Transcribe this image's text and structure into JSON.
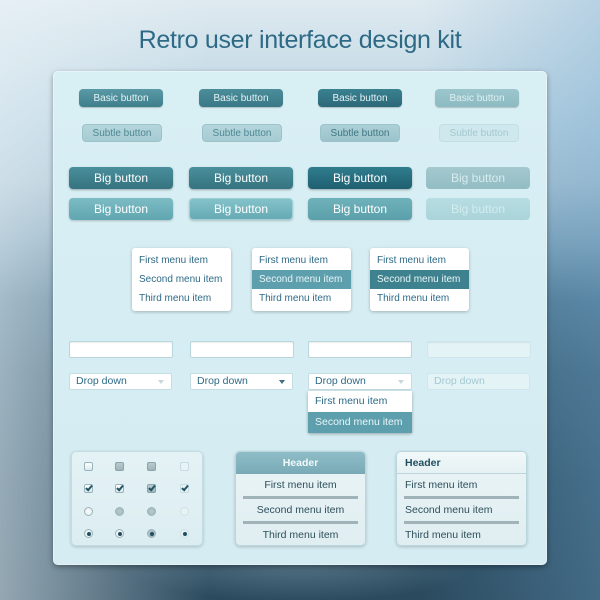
{
  "title": "Retro user interface design kit",
  "basic_buttons": [
    {
      "label": "Basic button",
      "state": "normal"
    },
    {
      "label": "Basic button",
      "state": "hover"
    },
    {
      "label": "Basic button",
      "state": "pressed"
    },
    {
      "label": "Basic button",
      "state": "disabled"
    }
  ],
  "subtle_buttons": [
    {
      "label": "Subtle button",
      "state": "normal"
    },
    {
      "label": "Subtle button",
      "state": "hover"
    },
    {
      "label": "Subtle button",
      "state": "pressed"
    },
    {
      "label": "Subtle button",
      "state": "disabled"
    }
  ],
  "big_buttons_dark": [
    {
      "label": "Big button",
      "state": "normal"
    },
    {
      "label": "Big button",
      "state": "hover"
    },
    {
      "label": "Big button",
      "state": "pressed"
    },
    {
      "label": "Big button",
      "state": "disabled"
    }
  ],
  "big_buttons_light": [
    {
      "label": "Big button",
      "state": "normal"
    },
    {
      "label": "Big button",
      "state": "hover"
    },
    {
      "label": "Big button",
      "state": "pressed"
    },
    {
      "label": "Big button",
      "state": "disabled"
    }
  ],
  "menus": [
    {
      "items": [
        "First menu item",
        "Second menu item",
        "Third menu item"
      ],
      "selected": null
    },
    {
      "items": [
        "First menu item",
        "Second menu item",
        "Third menu item"
      ],
      "selected": 1
    },
    {
      "items": [
        "First menu item",
        "Second menu item",
        "Third menu item"
      ],
      "selected": 1
    }
  ],
  "inputs": [
    {
      "value": "",
      "state": "normal"
    },
    {
      "value": "",
      "state": "hover"
    },
    {
      "value": "",
      "state": "focus"
    },
    {
      "value": "",
      "state": "disabled"
    }
  ],
  "dropdowns": [
    {
      "label": "Drop down",
      "state": "normal"
    },
    {
      "label": "Drop down",
      "state": "hover"
    },
    {
      "label": "Drop down",
      "state": "open"
    },
    {
      "label": "Drop down",
      "state": "disabled"
    }
  ],
  "open_dropdown_options": {
    "items": [
      "First menu item",
      "Second menu item"
    ],
    "selected": 1
  },
  "checkbox_states": {
    "unchecked": [
      "normal",
      "hover",
      "pressed",
      "disabled"
    ],
    "checked": [
      "normal",
      "hover",
      "pressed",
      "disabled"
    ]
  },
  "radio_states": {
    "unselected": [
      "normal",
      "hover",
      "pressed",
      "disabled"
    ],
    "selected": [
      "normal",
      "hover",
      "pressed",
      "disabled"
    ]
  },
  "list_cards": [
    {
      "header": "Header",
      "items": [
        "First menu item",
        "Second menu item",
        "Third menu item"
      ],
      "align": "center"
    },
    {
      "header": "Header",
      "items": [
        "First menu item",
        "Second menu item",
        "Third menu item"
      ],
      "align": "left"
    }
  ]
}
